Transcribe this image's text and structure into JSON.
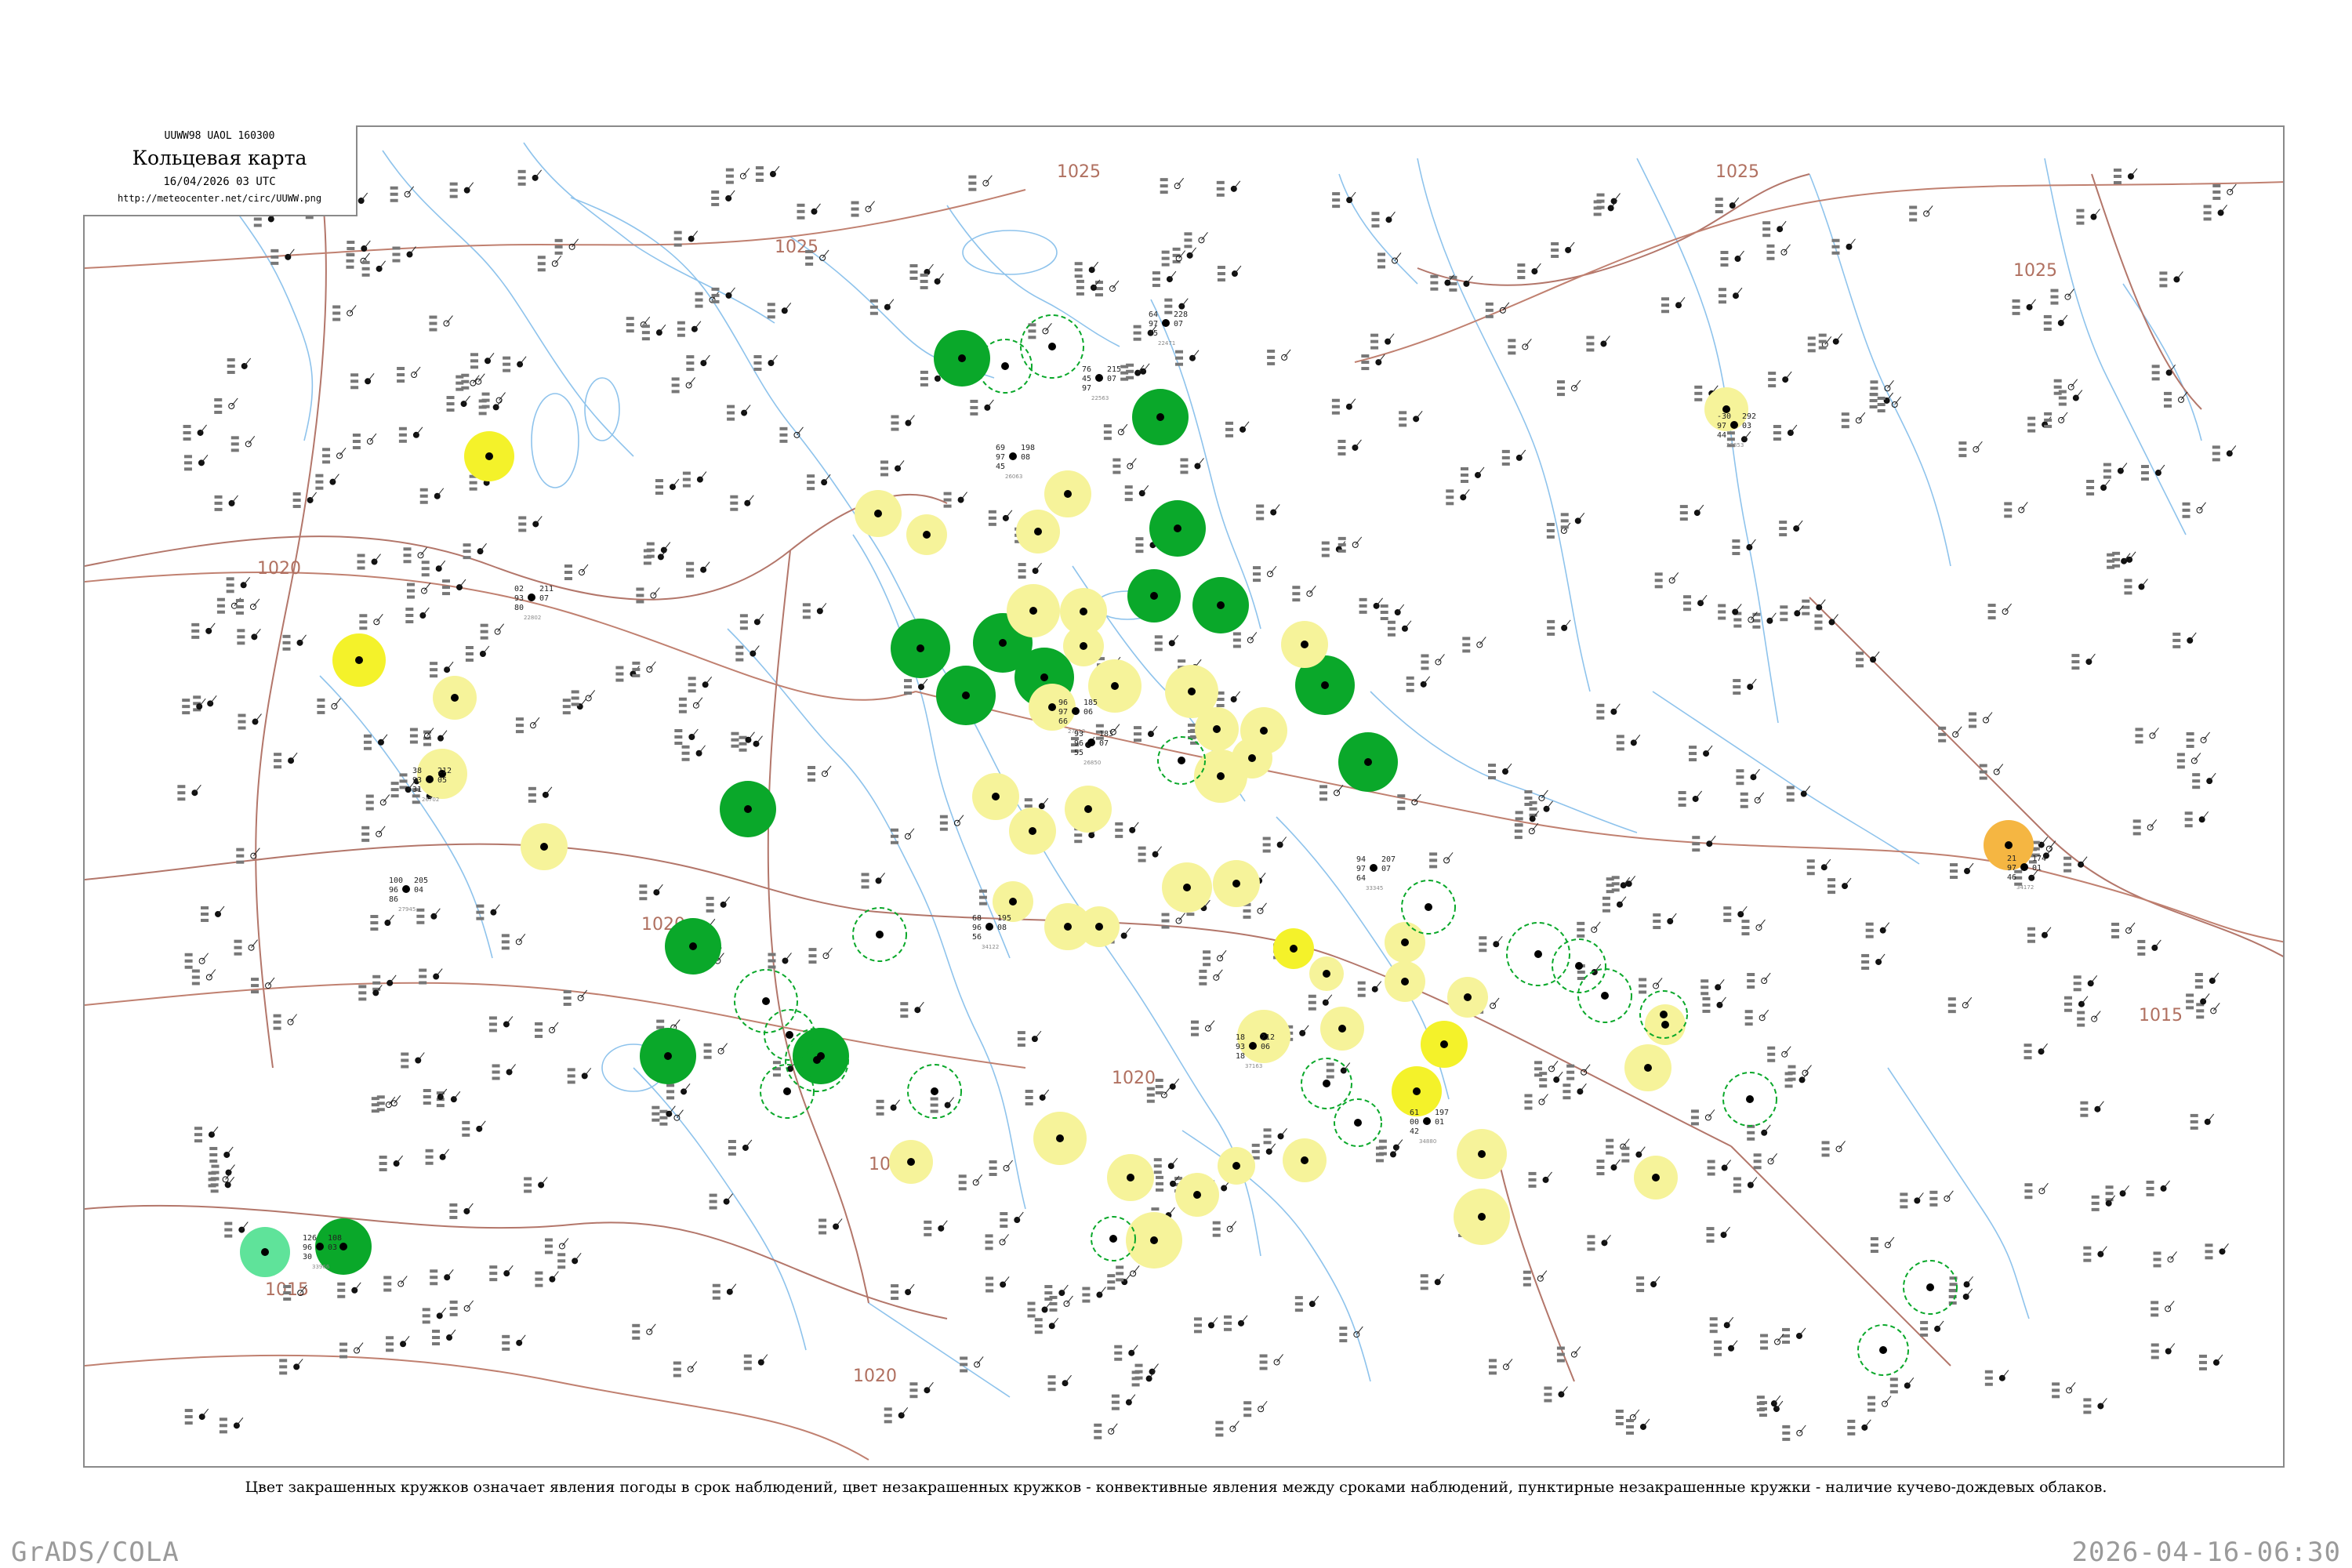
{
  "header": {
    "code": "UUWW98  UAOL  160300",
    "title": "Кольцевая карта",
    "datetime": "16/04/2026 03 UTC",
    "url": "http://meteocenter.net/circ/UUWW.png"
  },
  "caption": "Цвет закрашенных кружков означает явления погоды в срок наблюдений, цвет незакрашенных кружков - конвективные явления между сроками наблюдений, пунктирные незакрашенные кружки - наличие кучево-дождевых облаков.",
  "footer": {
    "left": "GrADS/COLA",
    "right": "2026-04-16-06:30"
  },
  "isobars": [
    "1025",
    "1025",
    "1025",
    "1025",
    "1020",
    "1020",
    "1020",
    "1020",
    "1020",
    "1015",
    "1015"
  ],
  "colors": {
    "green": "#0aa82a",
    "yellow": "#f4f22a",
    "paleyellow": "#f6f39a",
    "orange": "#f5b642",
    "lightgreen": "#5fe39a",
    "river": "#8ec3ec",
    "border": "#b3766a",
    "isobar": "#b07060"
  },
  "stations": [
    {
      "id": "22563",
      "v": [
        "76",
        "215",
        "45",
        "97",
        "07"
      ]
    },
    {
      "id": "22471",
      "v": [
        "64",
        "228",
        "97",
        "45",
        "07"
      ]
    },
    {
      "id": "26063",
      "v": [
        "69",
        "198",
        "97",
        "45",
        "08"
      ]
    },
    {
      "id": "27612",
      "v": [
        "96",
        "185",
        "97",
        "66",
        "06"
      ]
    },
    {
      "id": "26850",
      "v": [
        "93",
        "183",
        "96",
        "55",
        "07"
      ]
    },
    {
      "id": "33345",
      "v": [
        "94",
        "207",
        "97",
        "64",
        "07"
      ]
    },
    {
      "id": "34122",
      "v": [
        "68",
        "195",
        "96",
        "56",
        "08"
      ]
    },
    {
      "id": "27945",
      "v": [
        "100",
        "205",
        "96",
        "86",
        "04"
      ]
    },
    {
      "id": "22802",
      "v": [
        "02",
        "211",
        "93",
        "80",
        "07"
      ]
    },
    {
      "id": "26702",
      "v": [
        "38",
        "212",
        "93",
        "31",
        "05"
      ]
    },
    {
      "id": "34880",
      "v": [
        "61",
        "197",
        "00",
        "42",
        "01"
      ]
    },
    {
      "id": "37163",
      "v": [
        "18",
        "212",
        "93",
        "18",
        "06"
      ]
    },
    {
      "id": "33966",
      "v": [
        "126",
        "108",
        "96",
        "30",
        "03"
      ]
    },
    {
      "id": "34172",
      "v": [
        "21",
        "174",
        "97",
        "46",
        "01"
      ]
    },
    {
      "id": "23853",
      "v": [
        "-30",
        "292",
        "97",
        "44",
        "03"
      ]
    }
  ]
}
